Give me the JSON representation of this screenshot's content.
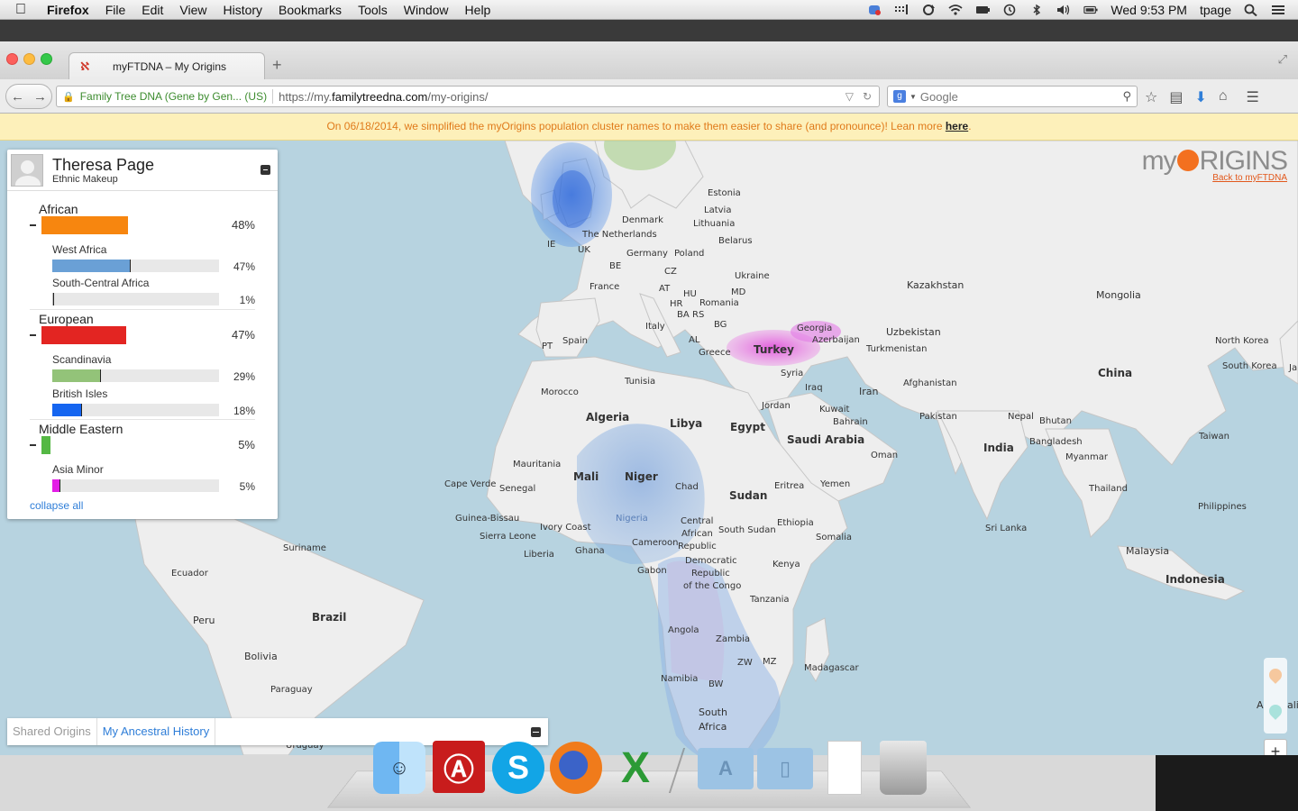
{
  "menubar": {
    "items": [
      "Firefox",
      "File",
      "Edit",
      "View",
      "History",
      "Bookmarks",
      "Tools",
      "Window",
      "Help"
    ],
    "clock": "Wed 9:53 PM",
    "user": "tpage"
  },
  "browser": {
    "tab_title": "myFTDNA – My Origins",
    "site_identity": "Family Tree DNA (Gene by Gen... (US)",
    "url_prefix": "https://my.",
    "url_domain": "familytreedna.com",
    "url_path": "/my-origins/",
    "search_engine": "Google",
    "search_placeholder": "Google"
  },
  "banner": {
    "text": "On 06/18/2014, we simplified the myOrigins population cluster names to make them easier to share (and pronounce)! Lean more",
    "link": "here",
    "suffix": "."
  },
  "logo": {
    "prefix": "my",
    "suffix": "RIGINS",
    "back_link": "Back to myFTDNA"
  },
  "panel": {
    "name": "Theresa Page",
    "subtitle": "Ethnic Makeup",
    "groups": [
      {
        "name": "African",
        "percent": "48%",
        "value": 48,
        "color": "#f7860f",
        "subgroups": [
          {
            "name": "West Africa",
            "percent": "47%",
            "value": 47,
            "color": "#6aa0d6"
          },
          {
            "name": "South-Central Africa",
            "percent": "1%",
            "value": 1,
            "color": "#b9b9b9"
          }
        ]
      },
      {
        "name": "European",
        "percent": "47%",
        "value": 47,
        "color": "#e32522",
        "subgroups": [
          {
            "name": "Scandinavia",
            "percent": "29%",
            "value": 29,
            "color": "#93c379"
          },
          {
            "name": "British Isles",
            "percent": "18%",
            "value": 18,
            "color": "#1565f0"
          }
        ]
      },
      {
        "name": "Middle Eastern",
        "percent": "5%",
        "value": 5,
        "color": "#55b844",
        "subgroups": [
          {
            "name": "Asia Minor",
            "percent": "5%",
            "value": 5,
            "color": "#e31ee6"
          }
        ]
      }
    ],
    "collapse_label": "collapse all"
  },
  "bottom_tabs": [
    "Shared Origins",
    "My Ancestral History"
  ],
  "map_labels": {
    "estonia": "Estonia",
    "latvia": "Latvia",
    "lithuania": "Lithuania",
    "denmark": "Denmark",
    "netherlands": "The Netherlands",
    "ie": "IE",
    "uk": "UK",
    "be": "BE",
    "germany": "Germany",
    "poland": "Poland",
    "belarus": "Belarus",
    "cz": "CZ",
    "ukraine": "Ukraine",
    "france": "France",
    "at": "AT",
    "hu": "HU",
    "md": "MD",
    "hr": "HR",
    "romania": "Romania",
    "ba": "BA",
    "rs": "RS",
    "bg": "BG",
    "italy": "Italy",
    "al": "AL",
    "greece": "Greece",
    "pt": "PT",
    "spain": "Spain",
    "kazakhstan": "Kazakhstan",
    "mongolia": "Mongolia",
    "georgia": "Georgia",
    "azerbaijan": "Azerbaijan",
    "uzbekistan": "Uzbekistan",
    "turkmenistan": "Turkmenistan",
    "turkey": "Turkey",
    "north_korea": "North Korea",
    "south_korea": "South Korea",
    "ja": "Ja",
    "china": "China",
    "syria": "Syria",
    "iraq": "Iraq",
    "iran": "Iran",
    "afghanistan": "Afghanistan",
    "tunisia": "Tunisia",
    "morocco": "Morocco",
    "jordan": "Jordan",
    "kuwait": "Kuwait",
    "bahrain": "Bahrain",
    "pakistan": "Pakistan",
    "nepal": "Nepal",
    "bhutan": "Bhutan",
    "taiwan": "Taiwan",
    "algeria": "Algeria",
    "libya": "Libya",
    "egypt": "Egypt",
    "saudi_arabia": "Saudi Arabia",
    "bangladesh": "Bangladesh",
    "india": "India",
    "myanmar": "Myanmar",
    "oman": "Oman",
    "mauritania": "Mauritania",
    "mali": "Mali",
    "niger": "Niger",
    "chad": "Chad",
    "eritrea": "Eritrea",
    "yemen": "Yemen",
    "thailand": "Thailand",
    "cape_verde": "Cape Verde",
    "senegal": "Senegal",
    "sudan": "Sudan",
    "philippines": "Philippines",
    "guinea_bissau": "Guinea-Bissau",
    "nigeria": "Nigeria",
    "ethiopia": "Ethiopia",
    "ivory_coast": "Ivory Coast",
    "central": "Central",
    "african": "African",
    "republic": "Republic",
    "south_sudan": "South Sudan",
    "sri_lanka": "Sri Lanka",
    "sierra_leone": "Sierra Leone",
    "cameroon": "Cameroon",
    "somalia": "Somalia",
    "liberia": "Liberia",
    "ghana": "Ghana",
    "suriname": "Suriname",
    "democratic": "Democratic",
    "republic2": "Republic",
    "of_the_congo": "of the Congo",
    "malaysia": "Malaysia",
    "gabon": "Gabon",
    "kenya": "Kenya",
    "ecuador": "Ecuador",
    "indonesia": "Indonesia",
    "tanzania": "Tanzania",
    "peru": "Peru",
    "brazil": "Brazil",
    "angola": "Angola",
    "zambia": "Zambia",
    "bolivia": "Bolivia",
    "zw": "ZW",
    "mz": "MZ",
    "madagascar": "Madagascar",
    "namibia": "Namibia",
    "paraguay": "Paraguay",
    "bw": "BW",
    "south": "South",
    "africa": "Africa",
    "uruguay": "Uruguay",
    "a_edge": "A",
    "ali_edge": "ali"
  },
  "zoom": {
    "in": "+",
    "out": "−"
  }
}
